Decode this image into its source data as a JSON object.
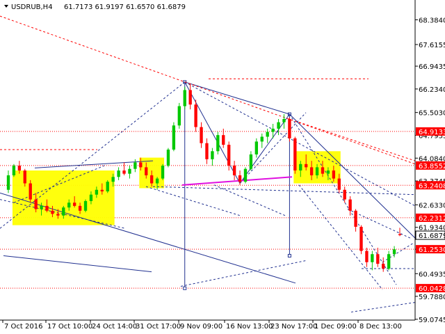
{
  "chart_data": {
    "type": "candlestick",
    "symbol_timeframe": "USDRUB,H4",
    "ohlc_header": "61.7173 61.9197 61.6570 61.6879",
    "colors": {
      "background": "#ffffff",
      "bull": "#00c800",
      "bear": "#ff0000",
      "grid": "#c0c0c0",
      "level_line": "#ff0000",
      "trend_line": "#1f2f8f",
      "zone": "#ffff00",
      "magenta_line": "#e010e0",
      "badge": "#ff0000",
      "current_price_badge": "#ffffff"
    },
    "ylim": [
      59.05,
      69.0
    ],
    "price_labels": [
      "68.3840",
      "67.6155",
      "66.9435",
      "66.2340",
      "65.5030",
      "64.7935",
      "64.0840",
      "63.3745",
      "62.6330",
      "61.9340",
      "61.2530",
      "60.4935",
      "59.7880",
      "59.0745"
    ],
    "x_labels": [
      "7 Oct 2016",
      "17 Oct 10:00",
      "24 Oct 14:00",
      "31 Oct 17:00",
      "9 Nov 09:00",
      "16 Nov 13:00",
      "23 Nov 17:00",
      "1 Dec 09:00",
      "8 Dec 13:00"
    ],
    "horizontal_levels": [
      {
        "price": 64.9133,
        "label": "64.9133"
      },
      {
        "price": 63.8552,
        "label": "63.8552"
      },
      {
        "price": 63.2408,
        "label": "63.2408"
      },
      {
        "price": 62.2312,
        "label": "62.2312"
      },
      {
        "price": 61.253,
        "label": "61.2530"
      },
      {
        "price": 60.0428,
        "label": "60.0428"
      }
    ],
    "current_price": "61.6879",
    "candles": [
      [
        63.1,
        63.7,
        63.0,
        63.55
      ],
      [
        63.55,
        63.9,
        63.5,
        63.85
      ],
      [
        63.85,
        64.0,
        63.6,
        63.7
      ],
      [
        63.7,
        63.75,
        63.2,
        63.3
      ],
      [
        63.3,
        63.4,
        62.7,
        62.8
      ],
      [
        62.8,
        63.0,
        62.4,
        62.5
      ],
      [
        62.5,
        62.7,
        62.3,
        62.6
      ],
      [
        62.6,
        62.8,
        62.4,
        62.45
      ],
      [
        62.45,
        62.6,
        62.25,
        62.35
      ],
      [
        62.35,
        62.5,
        62.2,
        62.3
      ],
      [
        62.3,
        62.6,
        62.2,
        62.55
      ],
      [
        62.55,
        62.8,
        62.45,
        62.7
      ],
      [
        62.7,
        62.9,
        62.55,
        62.6
      ],
      [
        62.6,
        62.7,
        62.35,
        62.45
      ],
      [
        62.45,
        62.8,
        62.4,
        62.75
      ],
      [
        62.75,
        63.05,
        62.65,
        62.95
      ],
      [
        62.95,
        63.2,
        62.85,
        63.1
      ],
      [
        63.1,
        63.3,
        62.95,
        63.05
      ],
      [
        63.05,
        63.4,
        63.0,
        63.35
      ],
      [
        63.35,
        63.6,
        63.2,
        63.5
      ],
      [
        63.5,
        63.8,
        63.4,
        63.7
      ],
      [
        63.7,
        63.95,
        63.55,
        63.6
      ],
      [
        63.6,
        63.85,
        63.45,
        63.75
      ],
      [
        63.75,
        64.05,
        63.65,
        63.95
      ],
      [
        63.95,
        64.1,
        63.7,
        63.8
      ],
      [
        63.8,
        63.95,
        63.45,
        63.55
      ],
      [
        63.55,
        63.7,
        63.2,
        63.3
      ],
      [
        63.3,
        63.5,
        63.1,
        63.45
      ],
      [
        63.45,
        63.9,
        63.4,
        63.85
      ],
      [
        63.85,
        64.4,
        63.8,
        64.35
      ],
      [
        64.35,
        65.2,
        64.3,
        65.1
      ],
      [
        65.1,
        65.8,
        65.0,
        65.7
      ],
      [
        65.7,
        66.3,
        65.6,
        66.2
      ],
      [
        66.2,
        66.4,
        65.6,
        65.75
      ],
      [
        65.75,
        65.9,
        64.9,
        65.05
      ],
      [
        65.05,
        65.2,
        64.4,
        64.55
      ],
      [
        64.55,
        64.7,
        63.9,
        64.05
      ],
      [
        64.05,
        64.4,
        63.85,
        64.3
      ],
      [
        64.3,
        64.9,
        64.2,
        64.8
      ],
      [
        64.8,
        65.0,
        64.4,
        64.5
      ],
      [
        64.5,
        64.6,
        63.7,
        63.85
      ],
      [
        63.85,
        64.0,
        63.4,
        63.55
      ],
      [
        63.55,
        63.7,
        63.25,
        63.35
      ],
      [
        63.35,
        63.8,
        63.3,
        63.75
      ],
      [
        63.75,
        64.3,
        63.7,
        64.2
      ],
      [
        64.2,
        64.7,
        64.1,
        64.6
      ],
      [
        64.6,
        64.85,
        64.4,
        64.75
      ],
      [
        64.75,
        65.0,
        64.55,
        64.9
      ],
      [
        64.9,
        65.15,
        64.7,
        65.0
      ],
      [
        65.0,
        65.3,
        64.8,
        65.2
      ],
      [
        65.2,
        65.45,
        65.0,
        65.3
      ],
      [
        65.3,
        65.35,
        64.6,
        64.7
      ],
      [
        64.7,
        64.75,
        63.6,
        63.7
      ],
      [
        63.7,
        64.0,
        63.5,
        63.9
      ],
      [
        63.9,
        64.2,
        63.7,
        63.8
      ],
      [
        63.8,
        64.0,
        63.4,
        63.55
      ],
      [
        63.55,
        63.9,
        63.45,
        63.8
      ],
      [
        63.8,
        64.0,
        63.5,
        63.6
      ],
      [
        63.6,
        63.8,
        63.4,
        63.7
      ],
      [
        63.7,
        63.85,
        63.35,
        63.45
      ],
      [
        63.45,
        63.6,
        63.0,
        63.1
      ],
      [
        63.1,
        63.2,
        62.7,
        62.8
      ],
      [
        62.8,
        62.9,
        62.3,
        62.45
      ],
      [
        62.45,
        62.5,
        61.8,
        61.95
      ],
      [
        61.95,
        62.0,
        61.1,
        61.2
      ],
      [
        61.2,
        61.3,
        60.7,
        60.85
      ],
      [
        60.85,
        61.2,
        60.6,
        61.1
      ],
      [
        61.1,
        61.3,
        60.7,
        60.8
      ],
      [
        60.8,
        61.0,
        60.55,
        60.65
      ],
      [
        60.65,
        61.2,
        60.6,
        61.1
      ],
      [
        61.1,
        61.35,
        61.0,
        61.25
      ],
      [
        61.72,
        61.92,
        61.66,
        61.69
      ]
    ],
    "zones": [
      {
        "p1": 63.7,
        "p2": 62.0,
        "t1": 1,
        "t2": 19
      },
      {
        "p1": 64.1,
        "p2": 63.15,
        "t1": 24,
        "t2": 28
      },
      {
        "p1": 64.3,
        "p2": 63.3,
        "t1": 52,
        "t2": 60
      }
    ],
    "trend_points": [
      {
        "t": 32,
        "p": 66.45,
        "label": "peak-1"
      },
      {
        "t": 51,
        "p": 65.45,
        "label": "peak-2"
      },
      {
        "t": 42,
        "p": 63.3,
        "label": "low-1"
      },
      {
        "t": 66,
        "p": 60.7,
        "label": "low-2"
      }
    ],
    "grid": true
  }
}
